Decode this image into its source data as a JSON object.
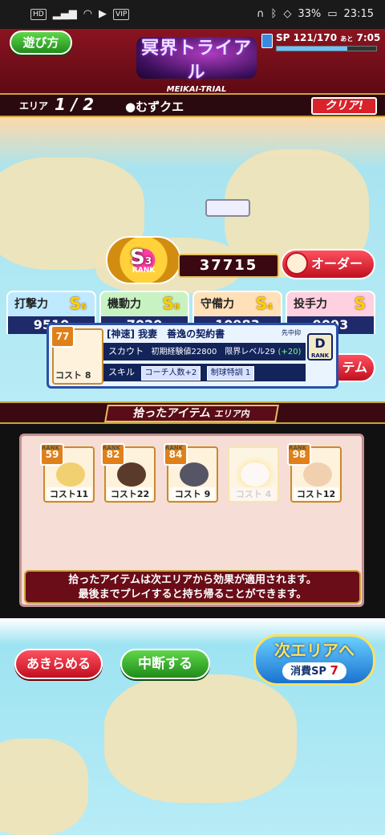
{
  "status_bar": {
    "left_badges": [
      "HD",
      "VIP"
    ],
    "battery": "33%",
    "time": "23:15"
  },
  "header": {
    "how_to_label": "遊び方",
    "logo_title": "冥界トライアル",
    "logo_subtitle": "MEIKAI-TRIAL",
    "sp_text": "SP 121/170",
    "sp_suffix": "あと",
    "sp_timer": "7:05",
    "sp_fill_fraction": 0.71
  },
  "area_bar": {
    "area_label": "エリア",
    "area_progress": "1 / 2",
    "area_name": "●むずクエ",
    "clear_label": "クリア!"
  },
  "team": {
    "rank_label": "RANK",
    "rank_grade": "S",
    "rank_level": "3",
    "total_score": "37715",
    "order_label": "オーダー",
    "stats": [
      {
        "name": "打撃力",
        "grade": "S",
        "level": "5",
        "value": "9510"
      },
      {
        "name": "機動力",
        "grade": "S",
        "level": "8",
        "value": "7020"
      },
      {
        "name": "守備力",
        "grade": "S",
        "level": "4",
        "value": "10983"
      },
      {
        "name": "投手力",
        "grade": "S",
        "level": "",
        "value": "9093"
      }
    ],
    "hidden_btn_label": "テム"
  },
  "card": {
    "rank": "77",
    "rank_label": "RANK",
    "cost": "コスト 8",
    "name": "[神速] 我妻　善逸の契約書",
    "position": "先中抑",
    "drank": "D",
    "drank_label": "RANK",
    "scout_label": "スカウト",
    "scout_text": "初期経験値22800　限界レベル29",
    "scout_bonus": "(+20)",
    "skill_label": "スキル",
    "skill_1": "コーチ人数+2",
    "skill_2": "制球特訓 1"
  },
  "items": {
    "title": "拾ったアイテム",
    "subtitle": "エリア内",
    "rank_label": "RANK",
    "list": [
      {
        "rank": "59",
        "cost": "コスト11"
      },
      {
        "rank": "82",
        "cost": "コスト22"
      },
      {
        "rank": "84",
        "cost": "コスト 9"
      },
      {
        "rank": "",
        "cost": "コスト 4"
      },
      {
        "rank": "98",
        "cost": "コスト12"
      }
    ],
    "note_line1": "拾ったアイテムは次エリアから効果が適用されます。",
    "note_line2": "最後までプレイすると持ち帰ることができます。"
  },
  "bottom": {
    "give_up_label": "あきらめる",
    "suspend_label": "中断する",
    "next_label": "次エリアへ",
    "cost_label": "消費SP",
    "cost_value": "7"
  }
}
